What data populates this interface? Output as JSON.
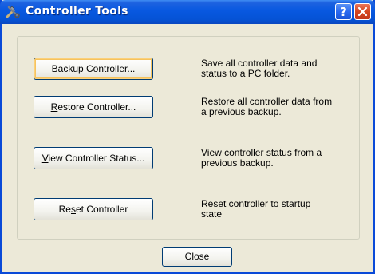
{
  "window": {
    "title": "Controller Tools",
    "icon": "tools-icon",
    "help_button": "?",
    "close_button": "×"
  },
  "actions": [
    {
      "label_pre": "",
      "label_key": "B",
      "label_post": "ackup Controller...",
      "description": "Save all controller data and\nstatus to a PC folder."
    },
    {
      "label_pre": "",
      "label_key": "R",
      "label_post": "estore Controller...",
      "description": "Restore all controller data from\na previous backup."
    },
    {
      "label_pre": "",
      "label_key": "V",
      "label_post": "iew Controller Status...",
      "description": "View controller status from a\nprevious backup."
    },
    {
      "label_pre": "Re",
      "label_key": "s",
      "label_post": "et Controller",
      "description": "Reset controller to startup\nstate"
    }
  ],
  "footer": {
    "close_label": "Close"
  },
  "colors": {
    "titlebar": "#0858e0",
    "close_red": "#d4451f",
    "face": "#ece9d8"
  }
}
